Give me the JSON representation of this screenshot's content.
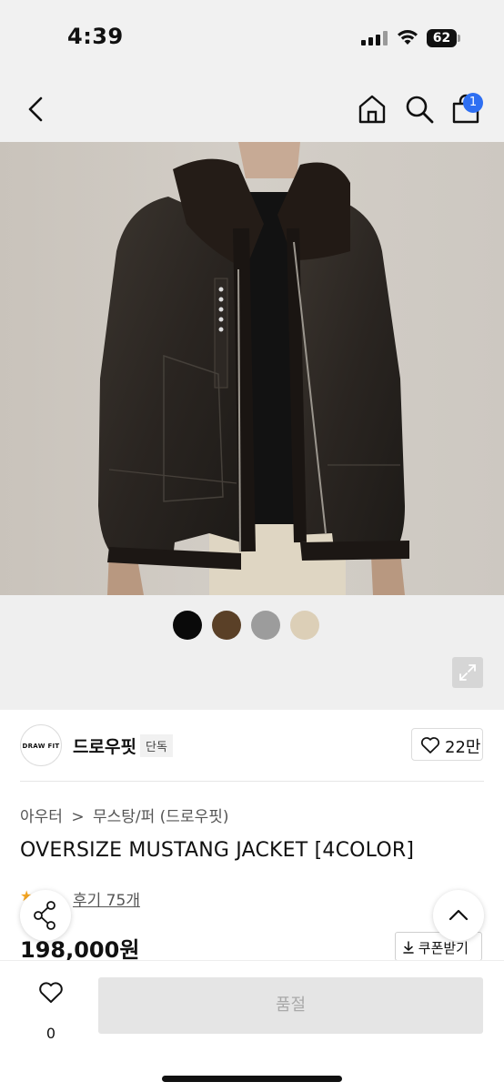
{
  "status_bar": {
    "time": "4:39",
    "battery": "62"
  },
  "nav": {
    "cart_count": "1"
  },
  "product": {
    "swatches": [
      {
        "name": "black",
        "color": "#0a0a0a"
      },
      {
        "name": "brown",
        "color": "#5a4027"
      },
      {
        "name": "gray",
        "color": "#9c9c9c"
      },
      {
        "name": "beige",
        "color": "#dccfb7"
      }
    ],
    "brand": {
      "logo_text": "DRAW FIT",
      "name": "드로우핏",
      "badge": "단독"
    },
    "likes": "22만",
    "breadcrumb": {
      "first": "아우터",
      "separator": ">",
      "second": "무스탕/퍼 (드로우핏)"
    },
    "title": "OVERSIZE MUSTANG JACKET [4COLOR]",
    "review_link": "후기 75개",
    "price": "198,000원",
    "coupon_label": "쿠폰받기"
  },
  "bottom_bar": {
    "wish_count": "0",
    "buy_label": "품절"
  }
}
